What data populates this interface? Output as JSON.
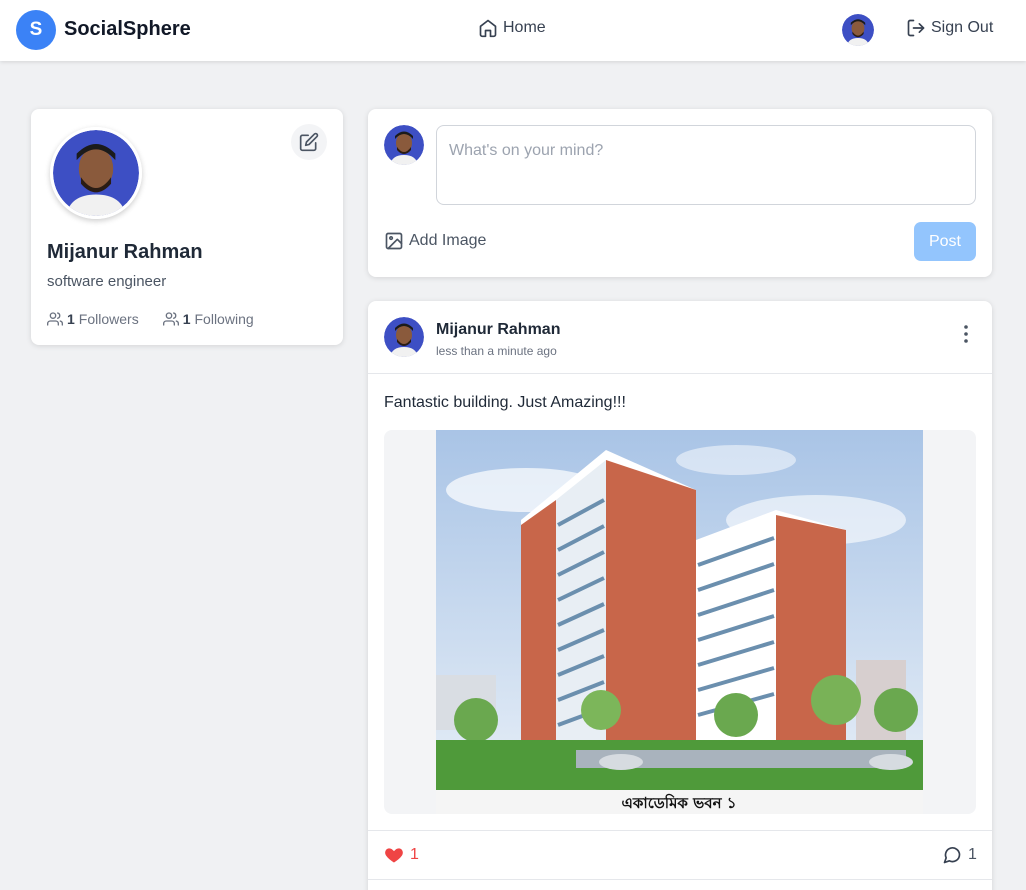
{
  "app": {
    "logo_letter": "S",
    "brand_name": "SocialSphere"
  },
  "nav": {
    "home_label": "Home",
    "signout_label": "Sign Out"
  },
  "profile": {
    "name": "Mijanur Rahman",
    "bio": "software engineer",
    "followers_count": "1",
    "followers_label": "Followers",
    "following_count": "1",
    "following_label": "Following"
  },
  "composer": {
    "placeholder": "What's on your mind?",
    "value": "",
    "add_image_label": "Add Image",
    "post_label": "Post"
  },
  "post": {
    "author": "Mijanur Rahman",
    "time": "less than a minute ago",
    "text": "Fantastic building. Just Amazing!!!",
    "image_caption": "একাডেমিক ভবন ১",
    "likes": "1",
    "comments": "1"
  },
  "colors": {
    "accent": "#3b82f6",
    "post_button_disabled": "#93c5fd",
    "like": "#ef4444",
    "background": "#f0f1f3"
  },
  "icons": {
    "home": "home-icon",
    "signout": "sign-out-icon",
    "edit": "edit-icon",
    "users": "users-icon",
    "image": "image-icon",
    "menu": "more-vertical-icon",
    "like": "heart-icon",
    "comment": "comment-icon"
  }
}
